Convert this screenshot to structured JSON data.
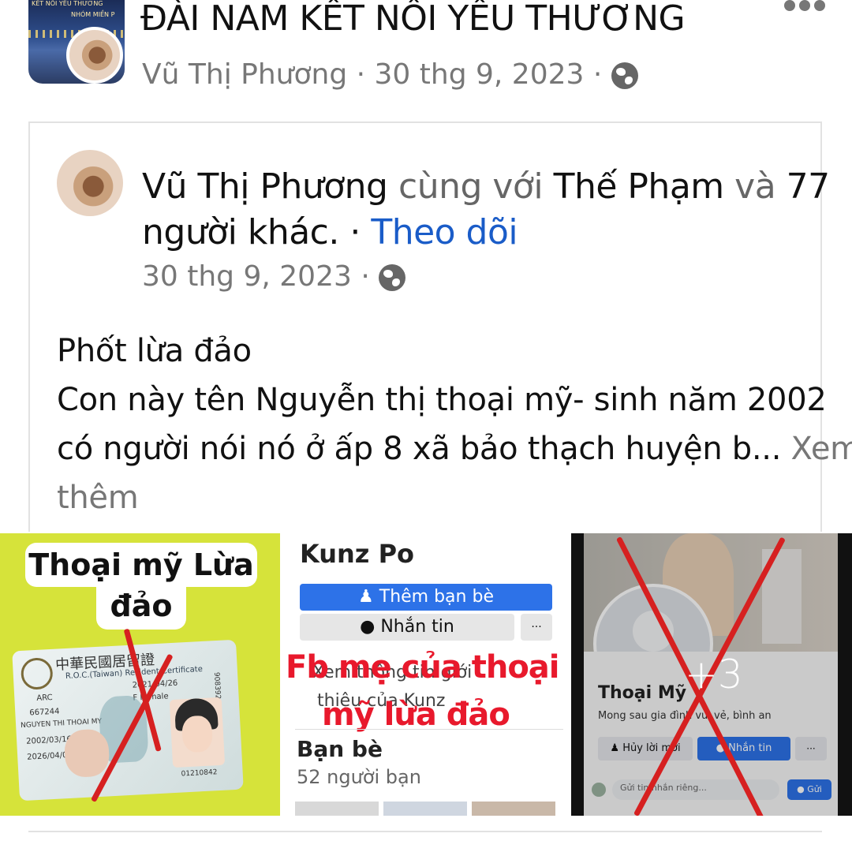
{
  "header": {
    "group_title": "ĐÀI NAM KẾT NỐI YÊU THƯƠNG",
    "thumb_text": "KẾT NỐI YÊU THƯƠNG",
    "thumb_text2": "NHÓM MIỀN P",
    "author": "Vũ Thị Phương",
    "date": "30 thg 9, 2023",
    "separator": " · ",
    "privacy_icon": "globe-icon",
    "more_icon": "more-dots-icon"
  },
  "post": {
    "author": "Vũ Thị Phương",
    "with_word": "cùng với",
    "tagged_person": "Thế Phạm",
    "and_word": "và",
    "others_count": "77",
    "others_label": "người khác.",
    "dot": " · ",
    "follow_label": "Theo dõi",
    "date": "30 thg 9, 2023",
    "separator": " · ",
    "body_lines": [
      "Phốt lừa đảo",
      "Con này tên Nguyễn thị thoại mỹ- sinh năm 2002",
      "có người nói nó ở ấp 8 xã bảo thạch huyện b..."
    ],
    "see_more_part1": "Xem",
    "see_more_part2": "thêm"
  },
  "images": {
    "img1": {
      "label_line1": "Thoại mỹ Lừa",
      "label_line2": "đảo",
      "card_header": "中華民國居留證",
      "card_sub": "R.O.C.(Taiwan) Resident Certificate",
      "card_arc": "ARC",
      "card_gender": "F Female",
      "card_date1": "2021/04/26",
      "card_date2": "2002/03/16",
      "card_date3": "2026/04/06",
      "card_num1": "667244",
      "card_num2": "908392",
      "card_num3": "01210842",
      "card_name": "NGUYEN THI THOAI MY"
    },
    "img2": {
      "profile_name": "Kunz Po",
      "add_friend": "Thêm bạn bè",
      "message": "Nhắn tin",
      "more": "···",
      "intro_line1": "Xem thông tin giới",
      "intro_line2": "thiệu của Kunz",
      "overlay_line1": "Fb mẹ của thoại",
      "overlay_line2": "mỹ lừa đảo",
      "friends_title": "Bạn bè",
      "friends_count": "52 người bạn"
    },
    "img3": {
      "name": "Thoại Mỹ",
      "bio": "Mong sau gia đình vui vẻ, bình an",
      "cancel_request": "Hủy lời mời",
      "message": "Nhắn tin",
      "more": "···",
      "compose_placeholder": "Gửi tin nhắn riêng...",
      "send": "Gửi",
      "more_count": "+3"
    }
  },
  "colors": {
    "link_blue": "#1a5cc8",
    "meta_gray": "#777777",
    "cross_red": "#d62020",
    "fb_blue": "#2d72e8",
    "lime_bg": "#d6e33a"
  }
}
